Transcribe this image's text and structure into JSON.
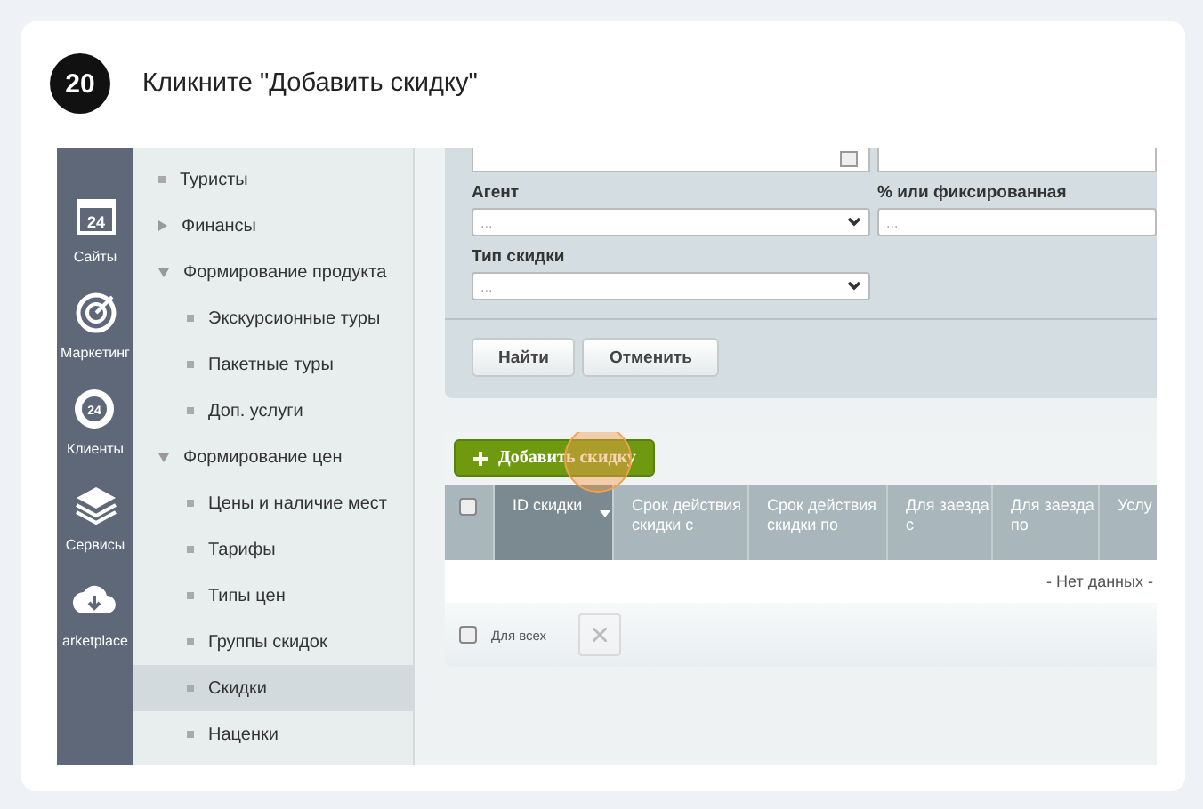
{
  "step": {
    "number": "20",
    "title": "Кликните \"Добавить скидку\""
  },
  "rail": [
    {
      "label": "Сайты",
      "kind": "calendar",
      "icon_text": "24"
    },
    {
      "label": "Маркетинг",
      "kind": "target"
    },
    {
      "label": "Клиенты",
      "kind": "cloud24",
      "icon_text": "24"
    },
    {
      "label": "Сервисы",
      "kind": "layers"
    },
    {
      "label": "arketplace",
      "kind": "download"
    }
  ],
  "tree": [
    {
      "children": [
        {
          "label": "Туристы",
          "selected": false
        }
      ]
    },
    {
      "label": "Финансы",
      "expanded": false,
      "selected": false
    },
    {
      "label": "Формирование продукта",
      "expanded": true,
      "selected": false,
      "children": [
        {
          "label": "Экскурсионные туры",
          "selected": false
        },
        {
          "label": "Пакетные туры",
          "selected": false
        },
        {
          "label": "Доп. услуги",
          "selected": false
        }
      ]
    },
    {
      "label": "Формирование цен",
      "expanded": true,
      "selected": false,
      "children": [
        {
          "label": "Цены и наличие мест",
          "selected": false
        },
        {
          "label": "Тарифы",
          "selected": false
        },
        {
          "label": "Типы цен",
          "selected": false
        },
        {
          "label": "Группы скидок",
          "selected": false
        },
        {
          "label": "Скидки",
          "selected": true
        },
        {
          "label": "Наценки",
          "selected": false
        }
      ]
    }
  ],
  "filter": {
    "fields": [
      {
        "label": "Агент",
        "kind": "select",
        "placeholder": "..."
      },
      {
        "label": "% или фиксированная",
        "kind": "input",
        "placeholder": "..."
      },
      {
        "label": "Тип скидки",
        "kind": "select",
        "placeholder": "..."
      }
    ],
    "buttons": [
      "Найти",
      "Отменить"
    ]
  },
  "add_button": "Добавить скидку",
  "table": {
    "columns": [
      {
        "label": "ID скидки",
        "sorted": true
      },
      {
        "label": "Срок действия скидки с",
        "sorted": false
      },
      {
        "label": "Срок действия скидки по",
        "sorted": false
      },
      {
        "label": "Для заезда с",
        "sorted": false
      },
      {
        "label": "Для заезда по",
        "sorted": false
      },
      {
        "label": "Услу",
        "sorted": false
      }
    ],
    "select_all": false,
    "empty_text": "- Нет данных -",
    "footer": {
      "label": "Для всех",
      "checked": false,
      "delete_disabled": true
    }
  }
}
